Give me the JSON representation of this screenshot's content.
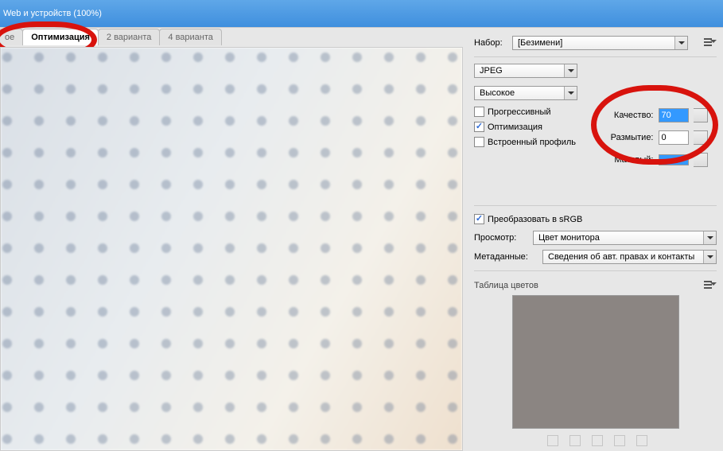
{
  "title": "Web и устройств (100%)",
  "tabs": {
    "cut": "ое",
    "optimize": "Оптимизация",
    "v2": "2 варианта",
    "v4": "4 варианта"
  },
  "preset": {
    "label": "Набор:",
    "value": "[Безимени]"
  },
  "format": {
    "value": "JPEG"
  },
  "quality_preset": {
    "value": "Высокое"
  },
  "quality": {
    "label": "Качество:",
    "value": "70"
  },
  "blur": {
    "label": "Размытие:",
    "value": "0"
  },
  "matte": {
    "label": "Матовый:"
  },
  "cb": {
    "progressive": "Прогрессивный",
    "optimize": "Оптимизация",
    "embedded": "Встроенный профиль",
    "srgb": "Преобразовать в sRGB"
  },
  "preview": {
    "label": "Просмотр:",
    "value": "Цвет монитора"
  },
  "metadata": {
    "label": "Метаданные:",
    "value": "Сведения об авт. правах и контакты"
  },
  "colortable": "Таблица цветов"
}
